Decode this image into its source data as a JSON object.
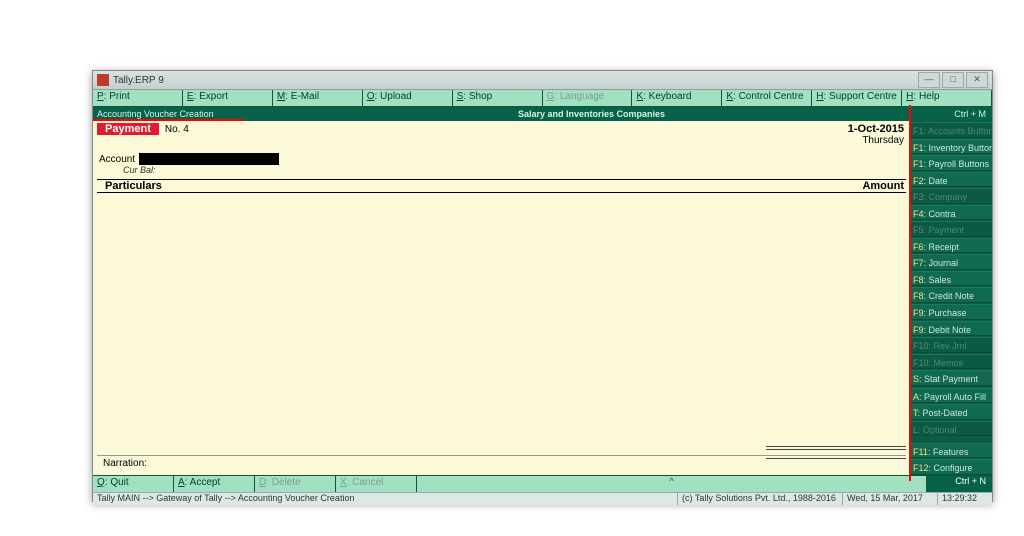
{
  "window": {
    "title": "Tally.ERP 9"
  },
  "toolbar": [
    {
      "key": "P",
      "label": ": Print"
    },
    {
      "key": "E",
      "label": ": Export"
    },
    {
      "key": "M",
      "label": ": E-Mail"
    },
    {
      "key": "O",
      "label": ": Upload"
    },
    {
      "key": "S",
      "label": ": Shop"
    },
    {
      "key": "G",
      "label": ": Language",
      "disabled": true
    },
    {
      "key": "K",
      "label": ": Keyboard"
    },
    {
      "key": "K",
      "label": ": Control Centre"
    },
    {
      "key": "H",
      "label": ": Support Centre"
    },
    {
      "key": "H",
      "label": ": Help"
    }
  ],
  "subheader": {
    "left": "Accounting Voucher Creation",
    "center": "Salary and Inventories Companies",
    "right": "Ctrl + M"
  },
  "voucher": {
    "type": "Payment",
    "no_label": "No.",
    "no": "4",
    "date": "1-Oct-2015",
    "day": "Thursday",
    "account_label": "Account",
    "curbal_label": "Cur Bal:",
    "col_particulars": "Particulars",
    "col_amount": "Amount",
    "narration_label": "Narration:"
  },
  "side": [
    {
      "k": "F1",
      "t": ": Accounts Buttons",
      "d": true
    },
    {
      "k": "F1",
      "t": ": Inventory Buttons"
    },
    {
      "k": "F1",
      "t": ": Payroll Buttons"
    },
    {
      "k": "F2",
      "t": ": Date"
    },
    {
      "k": "F3",
      "t": ": Company",
      "d": true
    },
    {
      "k": "F4",
      "t": ": Contra"
    },
    {
      "k": "F5",
      "t": ": Payment",
      "d": true
    },
    {
      "k": "F6",
      "t": ": Receipt"
    },
    {
      "k": "F7",
      "t": ": Journal"
    },
    {
      "k": "F8",
      "t": ": Sales"
    },
    {
      "k": "F8",
      "t": ": Credit Note"
    },
    {
      "k": "F9",
      "t": ": Purchase"
    },
    {
      "k": "F9",
      "t": ": Debit Note"
    },
    {
      "k": "F10",
      "t": ": Rev Jrnl",
      "d": true
    },
    {
      "k": "F10",
      "t": ": Memos",
      "d": true
    },
    {
      "k": "S",
      "t": ": Stat Payment"
    }
  ],
  "side2": [
    {
      "k": "A",
      "t": ": Payroll Auto Fill"
    },
    {
      "k": "T",
      "t": ": Post-Dated"
    },
    {
      "k": "L",
      "t": ": Optional",
      "d": true
    }
  ],
  "side3": [
    {
      "k": "F11",
      "t": ": Features"
    },
    {
      "k": "F12",
      "t": ": Configure"
    }
  ],
  "bottom": [
    {
      "key": "Q",
      "label": ": Quit"
    },
    {
      "key": "A",
      "label": ": Accept"
    },
    {
      "key": "D",
      "label": ": Delete",
      "disabled": true
    },
    {
      "key": "X",
      "label": ": Cancel",
      "disabled": true
    }
  ],
  "bottom_right": "Ctrl + N",
  "status": {
    "path": "Tally MAIN --> Gateway of Tally --> Accounting Voucher Creation",
    "copyright": "(c) Tally Solutions Pvt. Ltd., 1988-2016",
    "date": "Wed, 15 Mar, 2017",
    "time": "13:29:32"
  }
}
